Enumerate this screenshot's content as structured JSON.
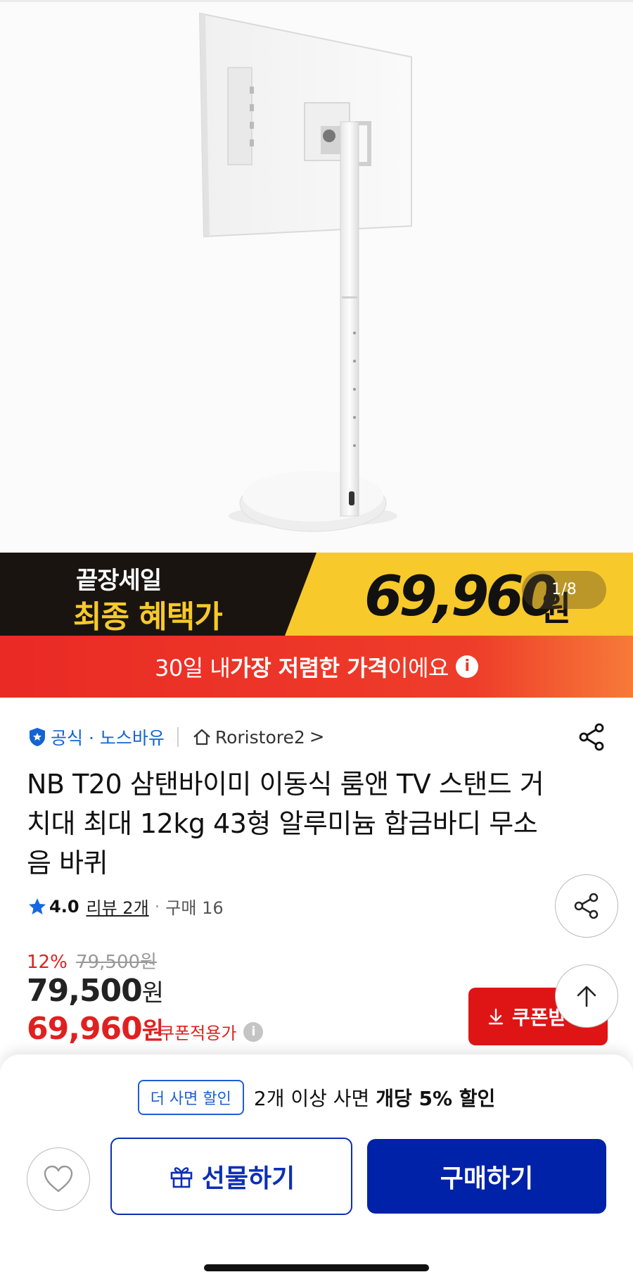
{
  "promo": {
    "line1": "끝장세일",
    "line2": "최종 혜택가",
    "price": "69,960",
    "won": "원",
    "page_indicator": "1/8"
  },
  "strip": {
    "prefix": "30일 내 ",
    "bold": "가장 저렴한 가격",
    "suffix": "이에요",
    "info_glyph": "i"
  },
  "store": {
    "official": "공식 · 노스바유",
    "name": "Roristore2",
    "chevron": ">"
  },
  "product": {
    "title": "NB T20 삼탠바이미 이동식 룸앤 TV 스탠드 거치대 최대 12kg 43형 알루미늄 합금바디 무소음 바퀴",
    "rating": "4.0",
    "review": "리뷰 2개",
    "sep": "·",
    "purchase": "구매 16"
  },
  "price": {
    "discount_rate": "12%",
    "original": "79,500원",
    "list_price": "79,500",
    "coupon_price": "69,960",
    "won": "원",
    "coupon_label": "쿠폰적용가",
    "info_glyph": "i",
    "coupon_button": "쿠폰받"
  },
  "bottom": {
    "bulk_badge": "더 사면 할인",
    "bulk_prefix": "2개 이상 사면 ",
    "bulk_bold": "개당 5% 할인",
    "gift_label": "선물하기",
    "buy_label": "구매하기"
  },
  "colors": {
    "accent_red": "#e02020",
    "accent_blue": "#0022a8",
    "promo_yellow": "#f7c92b"
  }
}
